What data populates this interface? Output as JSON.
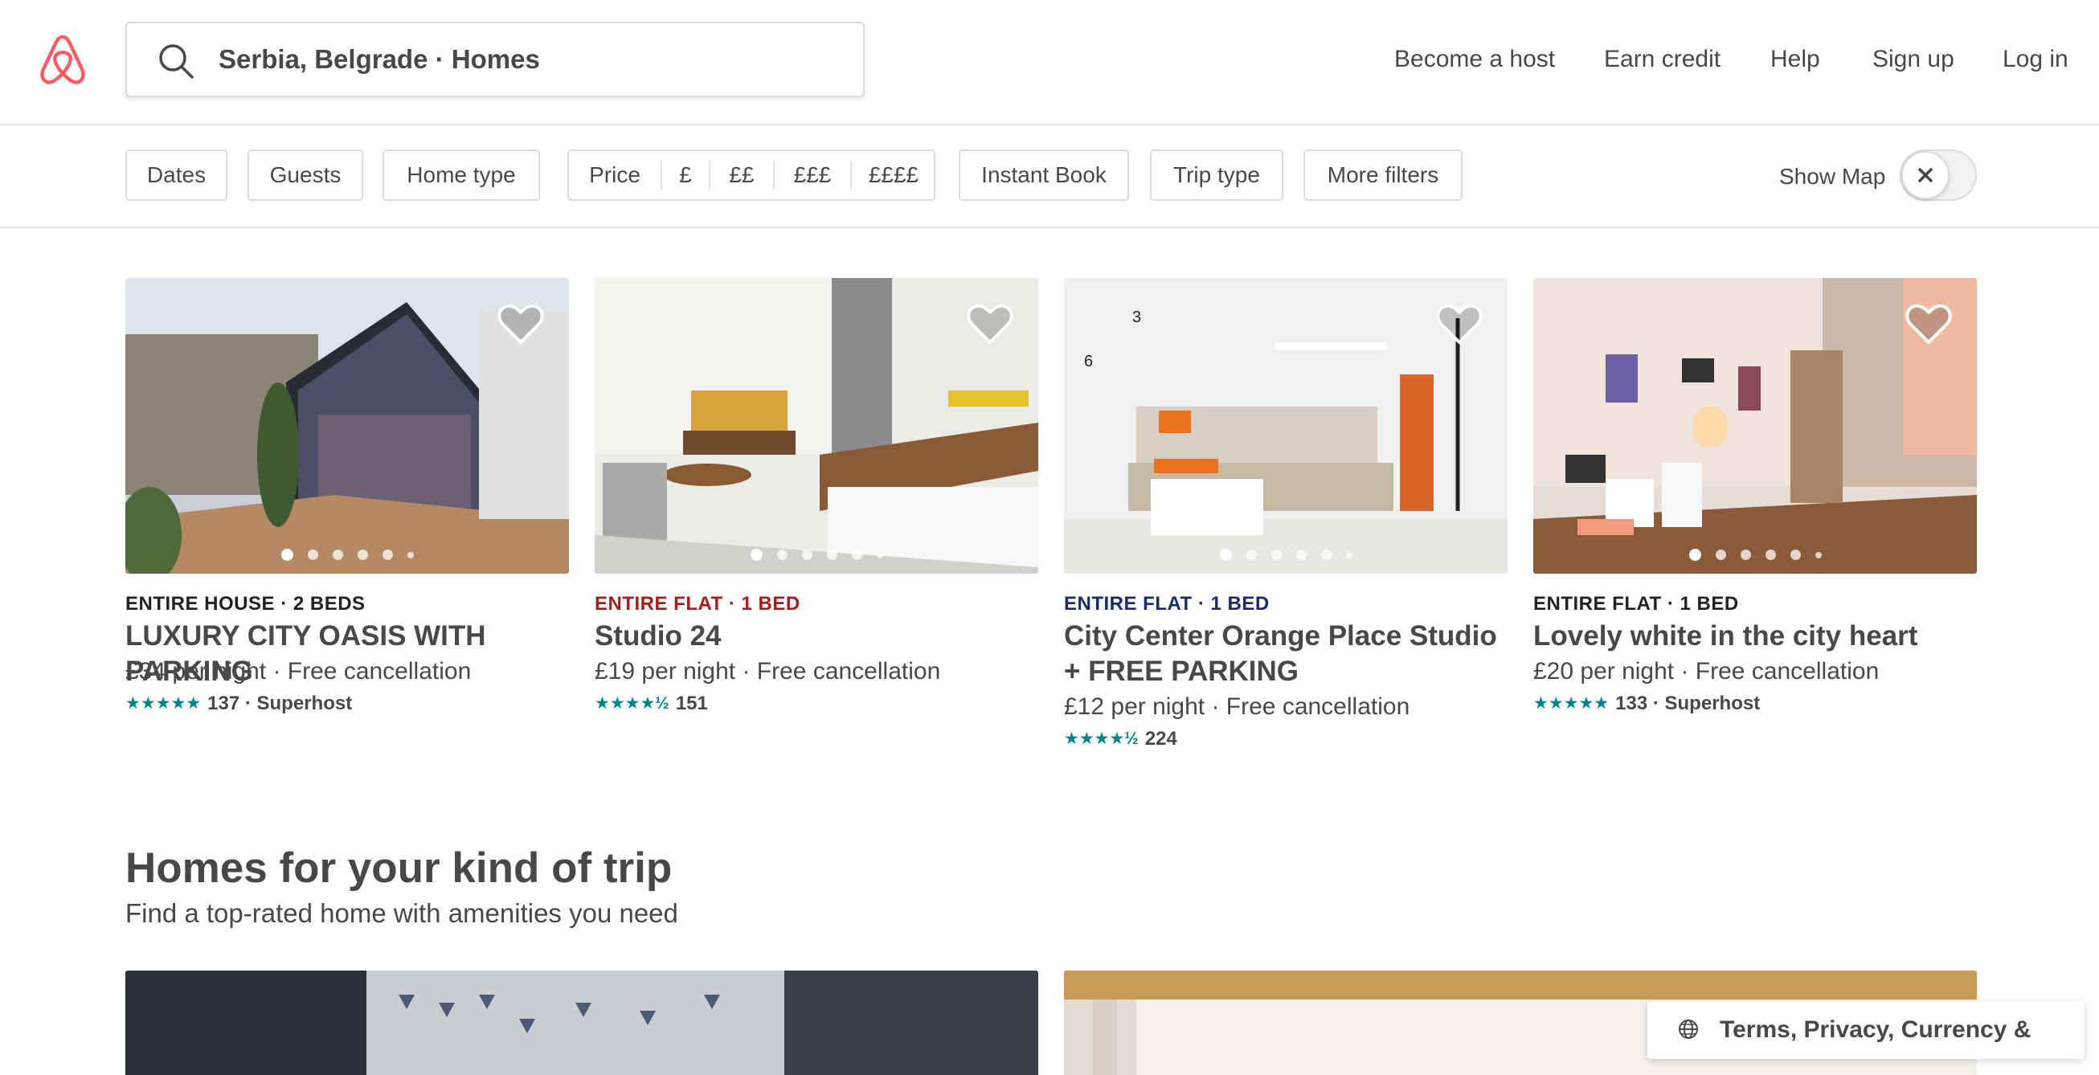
{
  "header": {
    "search_value": "Serbia, Belgrade · Homes",
    "nav": [
      "Become a host",
      "Earn credit",
      "Help",
      "Sign up",
      "Log in"
    ]
  },
  "filters": {
    "dates": "Dates",
    "guests": "Guests",
    "home_type": "Home type",
    "price_label": "Price",
    "price_options": [
      "£",
      "££",
      "£££",
      "££££"
    ],
    "instant_book": "Instant Book",
    "trip_type": "Trip type",
    "more_filters": "More filters",
    "show_map": "Show Map",
    "show_map_on": false
  },
  "listings": [
    {
      "kicker": "ENTIRE HOUSE · 2 BEDS",
      "kicker_color": "#222222",
      "title": "LUXURY CITY OASIS WITH PARKING",
      "price": "£34  per night · Free cancellation",
      "stars": "★★★★★",
      "rating_text": "137 · Superhost",
      "rating": 5
    },
    {
      "kicker": "ENTIRE FLAT · 1 BED",
      "kicker_color": "#a61d1d",
      "title": "Studio 24",
      "price": "£19  per night · Free cancellation",
      "stars": "★★★★½",
      "rating_text": "151",
      "rating": 4.5
    },
    {
      "kicker": "ENTIRE FLAT · 1 BED",
      "kicker_color": "#1a2b6b",
      "title": "City Center Orange Place Studio + FREE PARKING",
      "price": "£12  per night · Free cancellation",
      "stars": "★★★★½",
      "rating_text": "224",
      "rating": 4.5
    },
    {
      "kicker": "ENTIRE FLAT · 1 BED",
      "kicker_color": "#222222",
      "title": "Lovely white in the city heart",
      "price": "£20  per night · Free cancellation",
      "stars": "★★★★★",
      "rating_text": "133 · Superhost",
      "rating": 5
    }
  ],
  "section": {
    "title": "Homes for your kind of trip",
    "subtitle": "Find a top-rated home with amenities you need"
  },
  "footer": {
    "label": "Terms, Privacy, Currency & More"
  },
  "colors": {
    "brand": "#ff5a5f",
    "star": "#008489",
    "text": "#484848"
  }
}
